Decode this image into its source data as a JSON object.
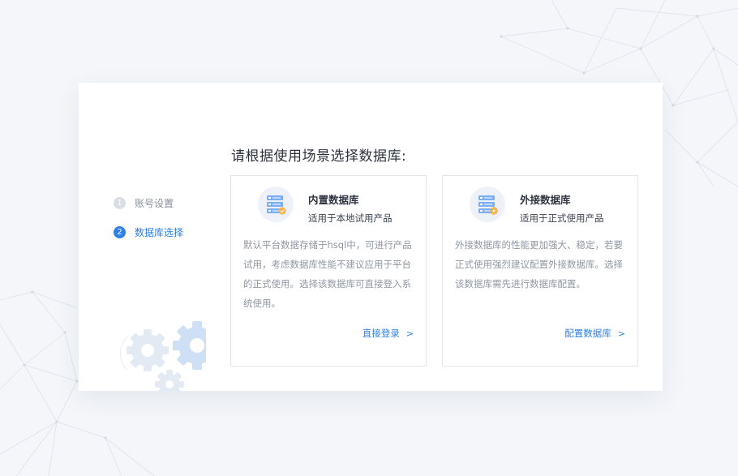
{
  "title": "请根据使用场景选择数据库:",
  "steps": [
    {
      "num": "1",
      "label": "账号设置",
      "state": "inactive"
    },
    {
      "num": "2",
      "label": "数据库选择",
      "state": "active"
    }
  ],
  "cards": [
    {
      "name": "内置数据库",
      "subtitle": "适用于本地试用产品",
      "description": "默认平台数据存储于hsql中，可进行产品试用，考虑数据库性能不建议应用于平台的正式使用。选择该数据库可直接登入系统使用。",
      "link": "直接登录",
      "chevron": ">",
      "icon": "database-check-icon"
    },
    {
      "name": "外接数据库",
      "subtitle": "适用于正式使用产品",
      "description": "外接数据库的性能更加强大、稳定，若要正式使用强烈建议配置外接数据库。选择该数据库需先进行数据库配置。",
      "link": "配置数据库",
      "chevron": ">",
      "icon": "database-gear-icon"
    }
  ],
  "colors": {
    "accent": "#2f7fe6",
    "background": "#f4f6f9",
    "icon_blue": "#7aaef5",
    "icon_orange": "#f5b24a"
  }
}
